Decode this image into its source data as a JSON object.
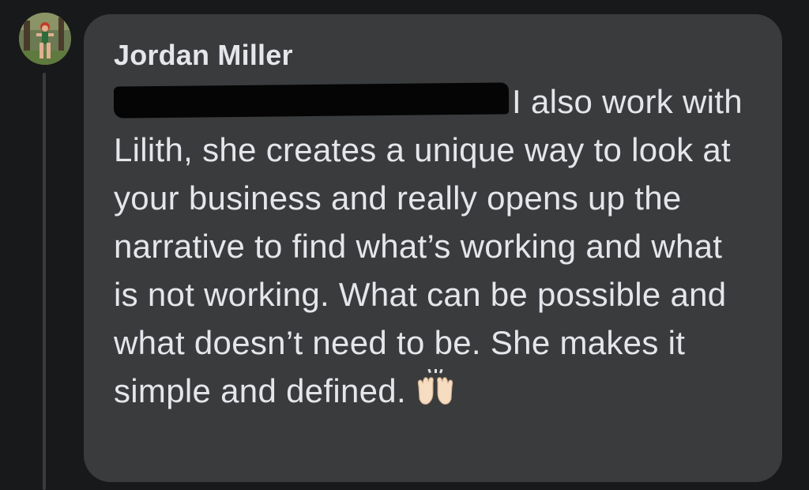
{
  "comment": {
    "author_name": "Jordan Miller",
    "text": "I also work with Lilith, she creates a unique way to look at your business and really opens up the narrative to find what’s working and what is not working. What can be possible and what doesn’t need to be. She makes it simple and defined.",
    "emoji": "raising-hands-emoji",
    "redacted_prefix": true
  },
  "colors": {
    "background": "#18191a",
    "bubble": "#3a3b3c",
    "text": "#e4e6eb",
    "redaction": "#050505"
  }
}
